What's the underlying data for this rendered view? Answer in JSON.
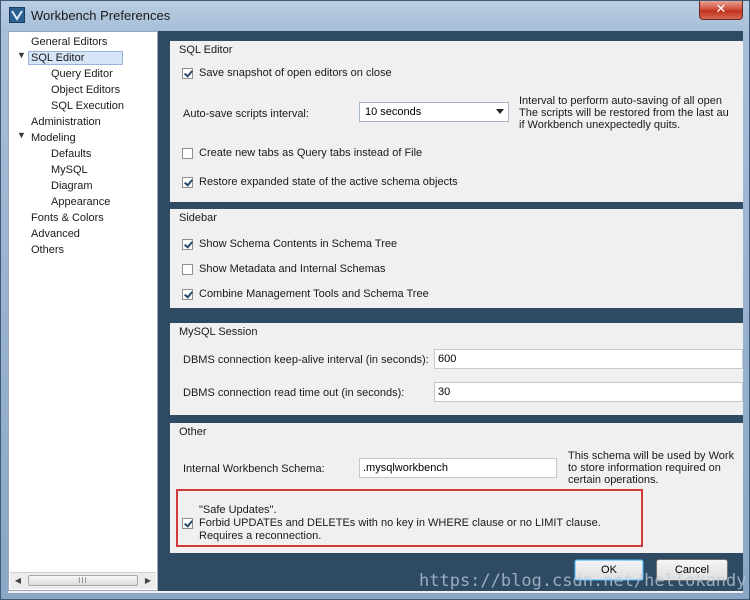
{
  "window": {
    "title": "Workbench Preferences"
  },
  "tree": {
    "items": [
      {
        "label": "General Editors"
      },
      {
        "label": "SQL Editor"
      },
      {
        "label": "Query Editor"
      },
      {
        "label": "Object Editors"
      },
      {
        "label": "SQL Execution"
      },
      {
        "label": "Administration"
      },
      {
        "label": "Modeling"
      },
      {
        "label": "Defaults"
      },
      {
        "label": "MySQL"
      },
      {
        "label": "Diagram"
      },
      {
        "label": "Appearance"
      },
      {
        "label": "Fonts & Colors"
      },
      {
        "label": "Advanced"
      },
      {
        "label": "Others"
      }
    ],
    "scroll_grip": "III"
  },
  "sql_editor": {
    "title": "SQL Editor",
    "save_snapshot": {
      "label": "Save snapshot of open editors on close",
      "checked": true
    },
    "autosave_label": "Auto-save scripts interval:",
    "autosave_value": "10 seconds",
    "autosave_note_1": "Interval to perform auto-saving of all open",
    "autosave_note_2": "The scripts will be restored from the last au",
    "autosave_note_3": "if Workbench unexpectedly quits.",
    "new_tabs": {
      "label": "Create new tabs as Query tabs instead of File",
      "checked": false
    },
    "restore_state": {
      "label": "Restore expanded state of the active schema objects",
      "checked": true
    }
  },
  "sidebar": {
    "title": "Sidebar",
    "show_schema": {
      "label": "Show Schema Contents in Schema Tree",
      "checked": true
    },
    "show_metadata": {
      "label": "Show Metadata and Internal Schemas",
      "checked": false
    },
    "combine_tools": {
      "label": "Combine Management Tools and Schema Tree",
      "checked": true
    }
  },
  "mysql_session": {
    "title": "MySQL Session",
    "keepalive_label": "DBMS connection keep-alive interval (in seconds):",
    "keepalive_value": "600",
    "readtimeout_label": "DBMS connection read time out (in seconds):",
    "readtimeout_value": "30"
  },
  "other": {
    "title": "Other",
    "schema_label": "Internal Workbench Schema:",
    "schema_value": ".mysqlworkbench",
    "schema_note_1": "This schema will be used by Work",
    "schema_note_2": "to store information required on",
    "schema_note_3": "certain operations.",
    "safe_updates_title": "\"Safe Updates\".",
    "safe_updates_desc": "Forbid UPDATEs and DELETEs with no key in WHERE clause or no LIMIT clause.",
    "safe_updates_note": "Requires a reconnection.",
    "safe_updates_checked": true
  },
  "buttons": {
    "ok": "OK",
    "cancel": "Cancel"
  },
  "watermark": "https://blog.csdn.net/hellokandy",
  "colors": {
    "highlight_box": "#d23a3a",
    "selection": "#d7e6f7"
  }
}
